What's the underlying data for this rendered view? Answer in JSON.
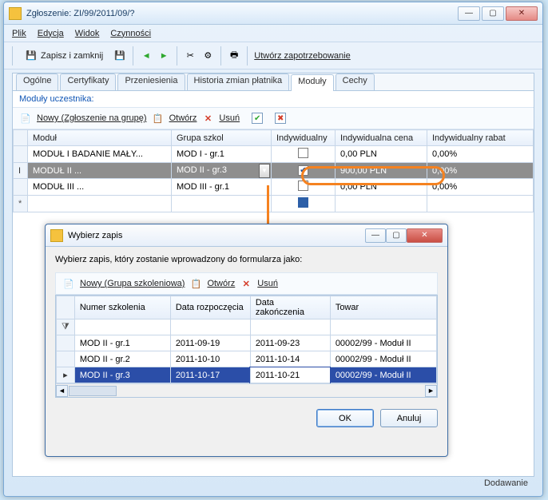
{
  "window": {
    "title": "Zgłoszenie: ZI/99/2011/09/?",
    "min": "—",
    "max": "▢",
    "close": "✕"
  },
  "menu": {
    "file": "Plik",
    "edit": "Edycja",
    "view": "Widok",
    "actions": "Czynności"
  },
  "toolbar": {
    "save_close": "Zapisz i zamknij",
    "create_req": "Utwórz zapotrzebowanie"
  },
  "tabs": [
    "Ogólne",
    "Certyfikaty",
    "Przeniesienia",
    "Historia zmian płatnika",
    "Moduły",
    "Cechy"
  ],
  "active_tab": 4,
  "section": "Moduły uczestnika:",
  "inner_tb": {
    "new": "Nowy (Zgłoszenie na grupę)",
    "open": "Otwórz",
    "del": "Usuń"
  },
  "grid": {
    "headers": [
      "",
      "Moduł",
      "Grupa szkol",
      "Indywidualny",
      "Indywidualna cena",
      "Indywidualny rabat"
    ],
    "rows": [
      {
        "rh": "",
        "mod": "MODUŁ I BADANIE MAŁY...",
        "gr": "MOD I - gr.1",
        "ind": false,
        "price": "0,00 PLN",
        "rabat": "0,00%"
      },
      {
        "rh": "I",
        "mod": "MODUŁ II ...",
        "gr": "MOD II - gr.3",
        "ind": true,
        "price": "900,00 PLN",
        "rabat": "0,00%",
        "sel": true,
        "dd": true
      },
      {
        "rh": "",
        "mod": "MODUŁ III ...",
        "gr": "MOD III - gr.1",
        "ind": false,
        "price": "0,00 PLN",
        "rabat": "0,00%"
      },
      {
        "rh": "*",
        "mod": "",
        "gr": "",
        "ind": "solid",
        "price": "",
        "rabat": ""
      }
    ]
  },
  "status": "Dodawanie",
  "dialog": {
    "title": "Wybierz zapis",
    "prompt": "Wybierz zapis, który zostanie wprowadzony do formularza jako:",
    "tb": {
      "new": "Nowy (Grupa szkoleniowa)",
      "open": "Otwórz",
      "del": "Usuń"
    },
    "headers": [
      "",
      "Numer szkolenia",
      "Data rozpoczęcia",
      "Data zakończenia",
      "Towar"
    ],
    "filter_rh": "⧩",
    "rows": [
      {
        "rh": "",
        "num": "MOD II - gr.1",
        "start": "2011-09-19",
        "end": "2011-09-23",
        "towar": "00002/99 - Moduł II"
      },
      {
        "rh": "",
        "num": "MOD II - gr.2",
        "start": "2011-10-10",
        "end": "2011-10-14",
        "towar": "00002/99 - Moduł II"
      },
      {
        "rh": "▸",
        "num": "MOD II - gr.3",
        "start": "2011-10-17",
        "end": "2011-10-21",
        "towar": "00002/99 - Moduł II",
        "sel": true
      }
    ],
    "ok": "OK",
    "cancel": "Anuluj"
  }
}
